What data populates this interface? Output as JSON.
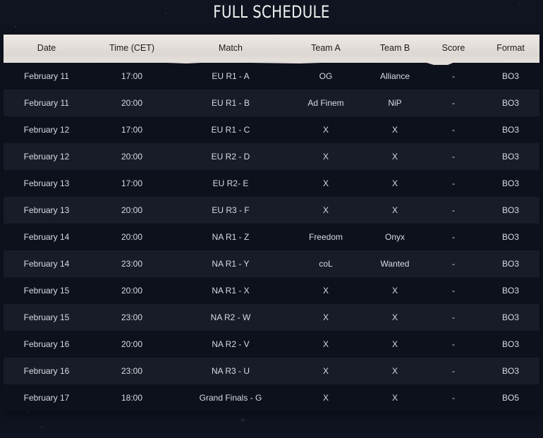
{
  "page": {
    "title": "FULL SCHEDULE"
  },
  "colors": {
    "background": "#0f1420",
    "row_dark": "#0c111c",
    "row_light": "#171c28",
    "header_paper": "#e7e2de",
    "text": "#d9dbe0"
  },
  "table": {
    "columns": [
      "Date",
      "Time (CET)",
      "Match",
      "Team A",
      "Team B",
      "Score",
      "Format"
    ],
    "rows": [
      [
        "February 11",
        "17:00",
        "EU R1 - A",
        "OG",
        "Alliance",
        "-",
        "BO3"
      ],
      [
        "February 11",
        "20:00",
        "EU R1 - B",
        "Ad Finem",
        "NiP",
        "-",
        "BO3"
      ],
      [
        "February 12",
        "17:00",
        "EU R1 - C",
        "X",
        "X",
        "-",
        "BO3"
      ],
      [
        "February 12",
        "20:00",
        "EU R2 - D",
        "X",
        "X",
        "-",
        "BO3"
      ],
      [
        "February 13",
        "17:00",
        "EU R2- E",
        "X",
        "X",
        "-",
        "BO3"
      ],
      [
        "February 13",
        "20:00",
        "EU R3 - F",
        "X",
        "X",
        "-",
        "BO3"
      ],
      [
        "February 14",
        "20:00",
        "NA R1 - Z",
        "Freedom",
        "Onyx",
        "-",
        "BO3"
      ],
      [
        "February 14",
        "23:00",
        "NA R1 - Y",
        "coL",
        "Wanted",
        "-",
        "BO3"
      ],
      [
        "February 15",
        "20:00",
        "NA R1 - X",
        "X",
        "X",
        "-",
        "BO3"
      ],
      [
        "February 15",
        "23:00",
        "NA R2 - W",
        "X",
        "X",
        "-",
        "BO3"
      ],
      [
        "February 16",
        "20:00",
        "NA R2 - V",
        "X",
        "X",
        "-",
        "BO3"
      ],
      [
        "February 16",
        "23:00",
        "NA R3 - U",
        "X",
        "X",
        "-",
        "BO3"
      ],
      [
        "February 17",
        "18:00",
        "Grand Finals - G",
        "X",
        "X",
        "-",
        "BO5"
      ]
    ]
  }
}
